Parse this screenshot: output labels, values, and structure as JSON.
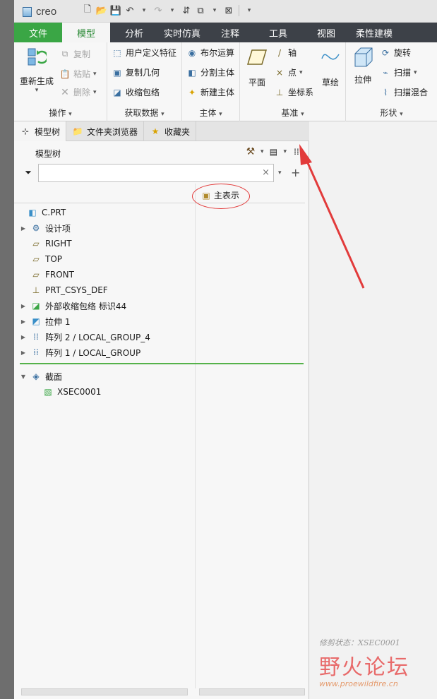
{
  "app": {
    "name": "creo",
    "logo_mark": "°"
  },
  "qat": {
    "icons": [
      "new-icon",
      "open-icon",
      "save-icon",
      "undo-icon",
      "redo-icon",
      "regenerate-icon",
      "window-icon",
      "close-window-icon",
      "customize-icon"
    ]
  },
  "tabs": [
    "文件",
    "模型",
    "分析",
    "实时仿真",
    "注释",
    "工具",
    "视图",
    "柔性建模"
  ],
  "ribbon": {
    "ops": {
      "regen": "重新生成",
      "copy": "复制",
      "paste": "粘贴",
      "delete": "删除",
      "label": "操作"
    },
    "data": {
      "udf": "用户定义特征",
      "copy_geom": "复制几何",
      "shrinkwrap": "收缩包络",
      "label": "获取数据"
    },
    "body": {
      "boolean": "布尔运算",
      "split": "分割主体",
      "new_body": "新建主体",
      "label": "主体"
    },
    "datum": {
      "plane": "平面",
      "axis": "轴",
      "point": "点",
      "csys": "坐标系",
      "sketch": "草绘",
      "label": "基准"
    },
    "shapes": {
      "extrude": "拉伸",
      "revolve": "旋转",
      "sweep": "扫描",
      "swept_blend": "扫描混合",
      "label": "形状"
    }
  },
  "panel_tabs": [
    "模型树",
    "文件夹浏览器",
    "收藏夹"
  ],
  "tree": {
    "title": "模型树",
    "search": {
      "value": "",
      "placeholder": ""
    },
    "column": "主表示",
    "nodes": [
      {
        "label": "C.PRT",
        "icon": "part-icon",
        "expand": false,
        "indent": 0
      },
      {
        "label": "设计项",
        "icon": "design-items-icon",
        "expand": true,
        "indent": 1
      },
      {
        "label": "RIGHT",
        "icon": "datum-plane-icon",
        "expand": false,
        "indent": 1
      },
      {
        "label": "TOP",
        "icon": "datum-plane-icon",
        "expand": false,
        "indent": 1
      },
      {
        "label": "FRONT",
        "icon": "datum-plane-icon",
        "expand": false,
        "indent": 1
      },
      {
        "label": "PRT_CSYS_DEF",
        "icon": "csys-icon",
        "expand": false,
        "indent": 1
      },
      {
        "label": "外部收缩包络 标识44",
        "icon": "shrinkwrap-icon",
        "expand": true,
        "indent": 1
      },
      {
        "label": "拉伸 1",
        "icon": "extrude-icon",
        "expand": true,
        "indent": 1
      },
      {
        "label": "阵列 2 / LOCAL_GROUP_4",
        "icon": "pattern-icon",
        "expand": true,
        "indent": 1
      },
      {
        "label": "阵列 1 / LOCAL_GROUP",
        "icon": "pattern-icon",
        "expand": true,
        "indent": 1
      }
    ],
    "sections": {
      "label": "截面",
      "child": "XSEC0001"
    }
  },
  "watermark": {
    "line1": "修剪状态：XSEC0001",
    "line2": "野火论坛",
    "line3": "www.proewildfire.cn"
  },
  "colors": {
    "file_tab": "#3aa645",
    "active_tab_text": "#2c8a37",
    "annotation": "#e23b3b",
    "divider": "#55b24a"
  }
}
